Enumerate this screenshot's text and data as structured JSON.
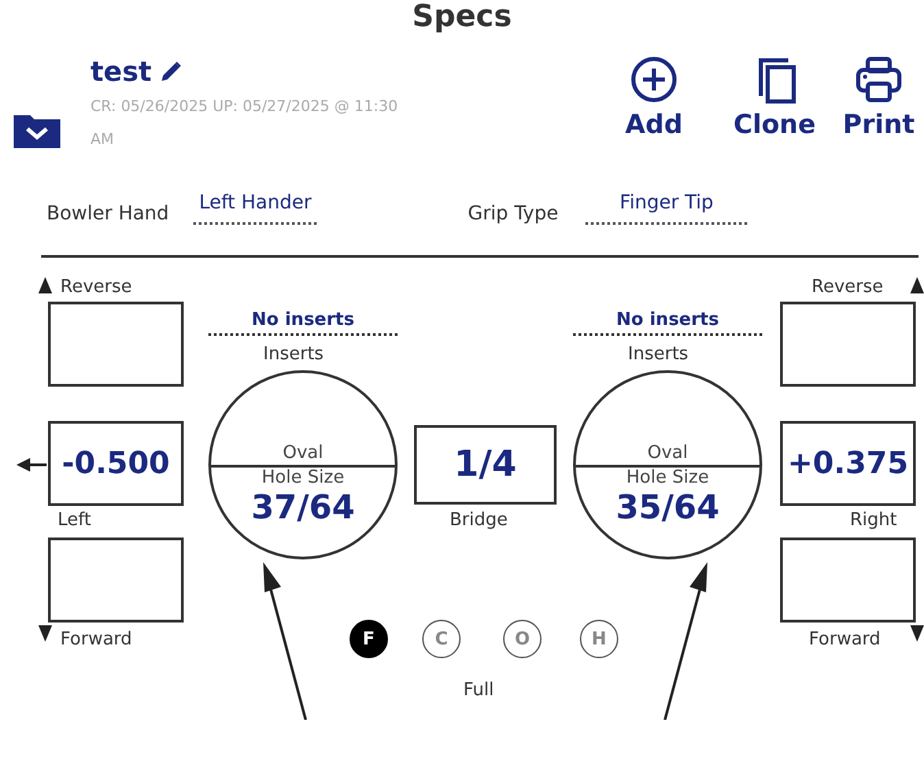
{
  "title": "Specs",
  "record": {
    "name": "test",
    "meta": "CR: 05/26/2025 UP: 05/27/2025 @ 11:30 AM"
  },
  "actions": [
    {
      "label": "Add",
      "kind": "add"
    },
    {
      "label": "Clone",
      "kind": "clone"
    },
    {
      "label": "Print",
      "kind": "print"
    }
  ],
  "fields": [
    {
      "label": "Bowler Hand",
      "value": "Left Hander"
    },
    {
      "label": "Grip Type",
      "value": "Finger Tip"
    }
  ],
  "sides": [
    {
      "reverse_label": "Reverse",
      "pitch": "-0.500",
      "pitch_label": "Left",
      "forward_label": "Forward"
    },
    {
      "reverse_label": "Reverse",
      "pitch": "+0.375",
      "pitch_label": "Right",
      "forward_label": "Forward"
    }
  ],
  "holes": [
    {
      "inserts": "No inserts",
      "inserts_label": "Inserts",
      "shape": "Oval",
      "size_label": "Hole Size",
      "size": "37/64"
    },
    {
      "inserts": "No inserts",
      "inserts_label": "Inserts",
      "shape": "Oval",
      "size_label": "Hole Size",
      "size": "35/64"
    }
  ],
  "bridge": {
    "value": "1/4",
    "label": "Bridge"
  },
  "grip_modes": [
    {
      "letter": "F",
      "selected": true
    },
    {
      "letter": "C",
      "selected": false
    },
    {
      "letter": "O",
      "selected": false
    },
    {
      "letter": "H",
      "selected": false
    }
  ],
  "grip_mode_label": "Full"
}
